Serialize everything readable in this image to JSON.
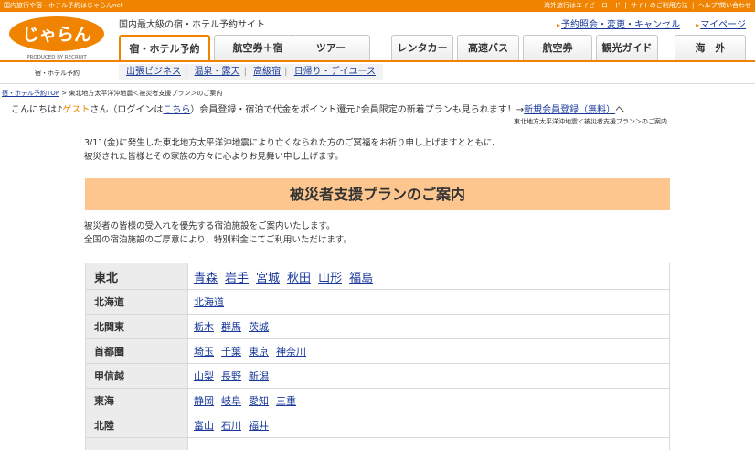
{
  "topbar": {
    "left": "国内旅行や宿・ホテル予約はじゃらんnet",
    "right": [
      "海外旅行はエイビーロード",
      "|",
      "サイトのご利用方法",
      "|",
      "ヘルプ/問い合わせ"
    ]
  },
  "logo": {
    "text": "じゃらん",
    "sub": "PRODUCED BY RECRUIT"
  },
  "site_desc": "国内最大級の宿・ホテル予約サイト",
  "top_links": [
    "予約照会・変更・キャンセル",
    "マイページ"
  ],
  "tabs": [
    "宿・ホテル予約",
    "航空券＋宿",
    "ツアー",
    "レンタカー",
    "高速バス",
    "航空券",
    "観光ガイド",
    "海　外"
  ],
  "subnav": {
    "label": "宿・ホテル予約",
    "links": [
      "出張ビジネス",
      "温泉・露天",
      "高級宿",
      "日帰り・デイユース"
    ]
  },
  "breadcrumb": {
    "home": "宿・ホテル予約TOP",
    "sep": " > ",
    "current": "東北地方太平洋沖地震＜被災者支援プラン＞のご案内"
  },
  "welcome": {
    "prefix": "こんにちは♪",
    "guest": "ゲスト",
    "san": "さん",
    "login_pre": "（ログインは",
    "login_link": "こちら",
    "login_post": "）会員登録・宿泊で代金をポイント還元♪会員限定の新着プランも見られます！→",
    "register": "新規会員登録（無料）",
    "tail": "へ"
  },
  "crumb_right": "東北地方太平洋沖地震＜被災者支援プラン＞のご案内",
  "condolence": [
    "3/11(金)に発生した東北地方太平洋沖地震により亡くなられた方のご冥福をお祈り申し上げますとともに、",
    "被災された皆様とその家族の方々に心よりお見舞い申し上げます。"
  ],
  "banner_title": "被災者支援プランのご案内",
  "intro": [
    "被災者の皆様の受入れを優先する宿泊施設をご案内いたします。",
    "全国の宿泊施設のご厚意により、特別料金にてご利用いただけます。"
  ],
  "regions": [
    {
      "name": "東北",
      "prefs": [
        "青森",
        "岩手",
        "宮城",
        "秋田",
        "山形",
        "福島"
      ]
    },
    {
      "name": "北海道",
      "prefs": [
        "北海道"
      ]
    },
    {
      "name": "北関東",
      "prefs": [
        "栃木",
        "群馬",
        "茨城"
      ]
    },
    {
      "name": "首都圏",
      "prefs": [
        "埼玉",
        "千葉",
        "東京",
        "神奈川"
      ]
    },
    {
      "name": "甲信越",
      "prefs": [
        "山梨",
        "長野",
        "新潟"
      ]
    },
    {
      "name": "東海",
      "prefs": [
        "静岡",
        "岐阜",
        "愛知",
        "三重"
      ]
    },
    {
      "name": "北陸",
      "prefs": [
        "富山",
        "石川",
        "福井"
      ]
    },
    {
      "name": "",
      "prefs": []
    }
  ],
  "colors": {
    "accent": "#f08300",
    "banner": "#fdc68e",
    "link": "#1a3a9a"
  }
}
